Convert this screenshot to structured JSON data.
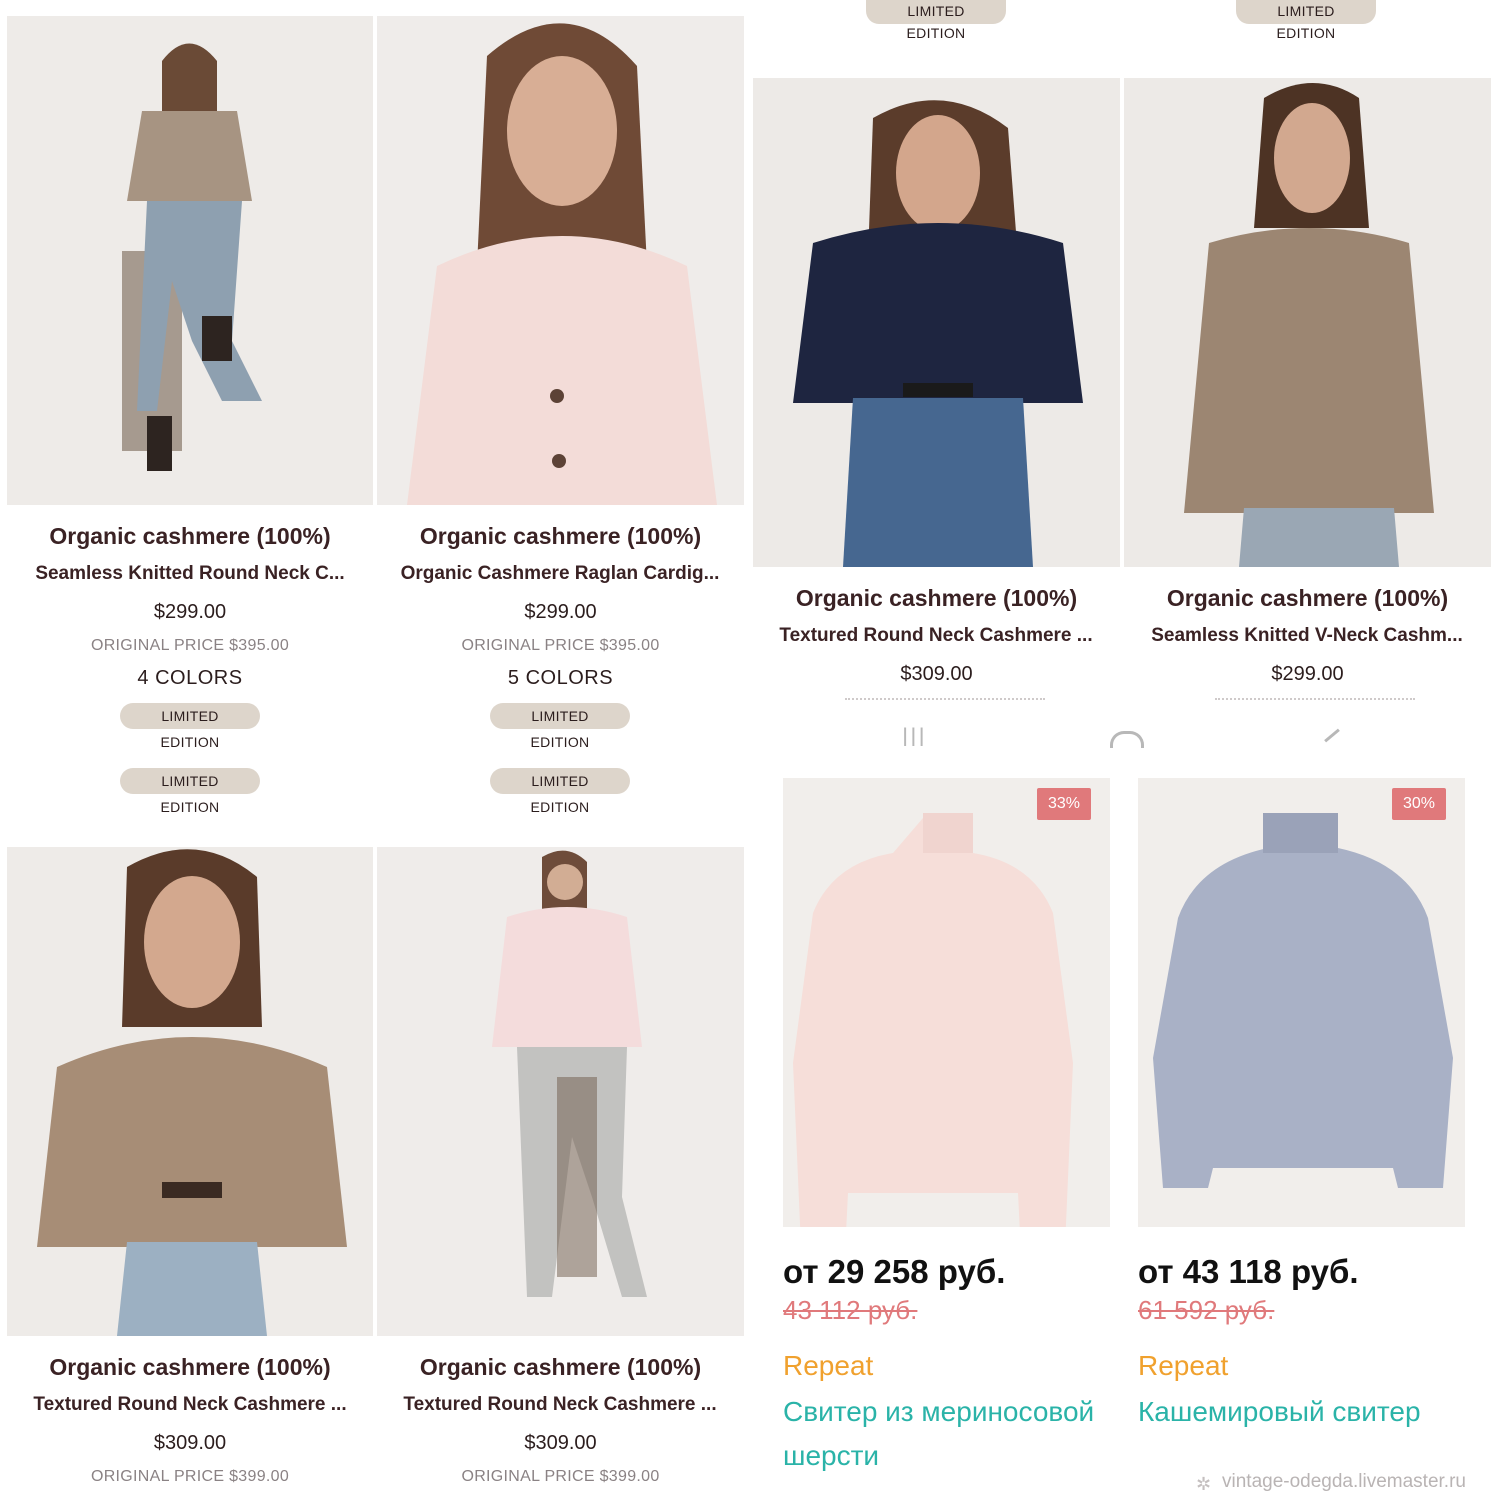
{
  "top_badges": [
    "LIMITED EDITION",
    "LIMITED EDITION"
  ],
  "left_cards": [
    {
      "title": "Organic cashmere (100%)",
      "name": "Seamless Knitted Round Neck C...",
      "price": "$299.00",
      "original": "ORIGINAL PRICE $395.00",
      "colors": "4 COLORS",
      "badge": "LIMITED EDITION",
      "badge2": "LIMITED EDITION",
      "sweater": "#a79482"
    },
    {
      "title": "Organic cashmere (100%)",
      "name": "Organic Cashmere Raglan Cardig...",
      "price": "$299.00",
      "original": "ORIGINAL PRICE $395.00",
      "colors": "5 COLORS",
      "badge": "LIMITED EDITION",
      "badge2": "LIMITED EDITION",
      "sweater": "#f3dcd8"
    },
    {
      "title": "Organic cashmere (100%)",
      "name": "Textured Round Neck Cashmere ...",
      "price": "$309.00",
      "original": "ORIGINAL PRICE $399.00",
      "sweater": "#a78d76"
    },
    {
      "title": "Organic cashmere (100%)",
      "name": "Textured Round Neck Cashmere ...",
      "price": "$309.00",
      "original": "ORIGINAL PRICE $399.00",
      "sweater": "#f4dcdc"
    }
  ],
  "right_cards": [
    {
      "title": "Organic cashmere (100%)",
      "name": "Textured Round Neck Cashmere ...",
      "price": "$309.00",
      "sweater": "#1e2540"
    },
    {
      "title": "Organic cashmere (100%)",
      "name": "Seamless Knitted V-Neck Cashm...",
      "price": "$299.00",
      "sweater": "#9c8672"
    }
  ],
  "nav": {
    "recent": "|||",
    "home": "◯",
    "back": "‹"
  },
  "ru_cards": [
    {
      "discount": "33%",
      "price": "от 29 258 руб.",
      "old_price": "43 112 руб.",
      "brand": "Repeat",
      "name": "Свитер из мериносовой шерсти",
      "sweater": "#f6ded9"
    },
    {
      "discount": "30%",
      "price": "от 43 118 руб.",
      "old_price": "61 592 руб.",
      "brand": "Repeat",
      "name": "Кашемировый свитер",
      "sweater": "#a9b1c6"
    }
  ],
  "watermark": "vintage-odegda.livemaster.ru"
}
